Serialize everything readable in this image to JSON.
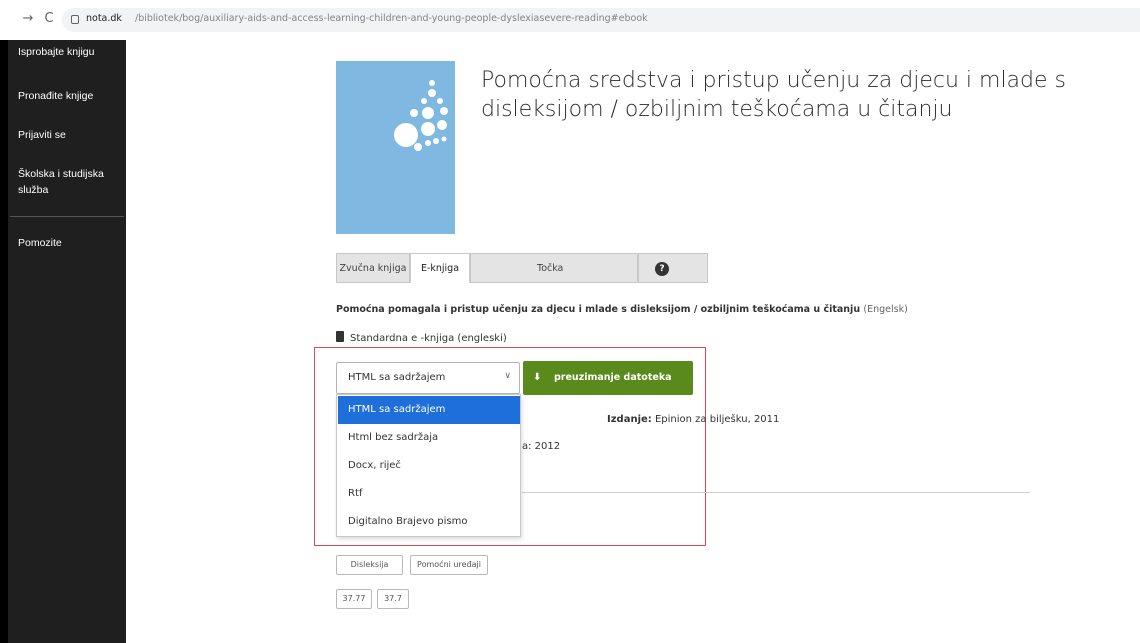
{
  "browser": {
    "url_domain": "nota.dk",
    "url_path": "/bibliotek/bog/auxiliary-aids-and-access-learning-children-and-young-people-dyslexiasevere-reading#ebook"
  },
  "sidebar": {
    "items": [
      {
        "label": "Isprobajte knjigu"
      },
      {
        "label": "Pronađite knjige"
      },
      {
        "label": "Prijaviti se"
      },
      {
        "label": "Školska i studijska služba"
      },
      {
        "label": "Pomozite"
      }
    ]
  },
  "book": {
    "title": "Pomoćna sredstva i pristup učenju za djecu i mlade s disleksijom / ozbiljnim teškoćama u čitanju"
  },
  "tabs": [
    {
      "label": "Zvučna knjiga",
      "active": false
    },
    {
      "label": "E-knjiga",
      "active": true
    },
    {
      "label": "Točka",
      "active": false
    }
  ],
  "help_icon": "?",
  "edition": {
    "title": "Pomoćna pomagala i pristup učenju za djecu i mlade s disleksijom / ozbiljnim teškoćama u čitanju",
    "language": "(Engelsk)",
    "format": "Standardna e -knjiga (engleski)"
  },
  "format_select": {
    "value": "HTML sa sadržajem",
    "options": [
      "HTML sa sadržajem",
      "Html bez sadržaja",
      "Docx, riječ",
      "Rtf",
      "Digitalno Brajevo pismo"
    ]
  },
  "download_button": {
    "label": "preuzimanje datoteka"
  },
  "publication": {
    "label": "Izdanje:",
    "value": "Epinion za bilješku, 2011",
    "year": "a: 2012"
  },
  "subject_tags": [
    "Disleksija",
    "Pomoćni uređaji"
  ],
  "class_tags": [
    "37.77",
    "37.7"
  ],
  "colors": {
    "sidebar_bg": "#1f1f1f",
    "cover": "#7fb8e1",
    "download_button": "#5a8a1c",
    "selected_option": "#1e6fd9",
    "highlight_frame": "#d9485a"
  }
}
